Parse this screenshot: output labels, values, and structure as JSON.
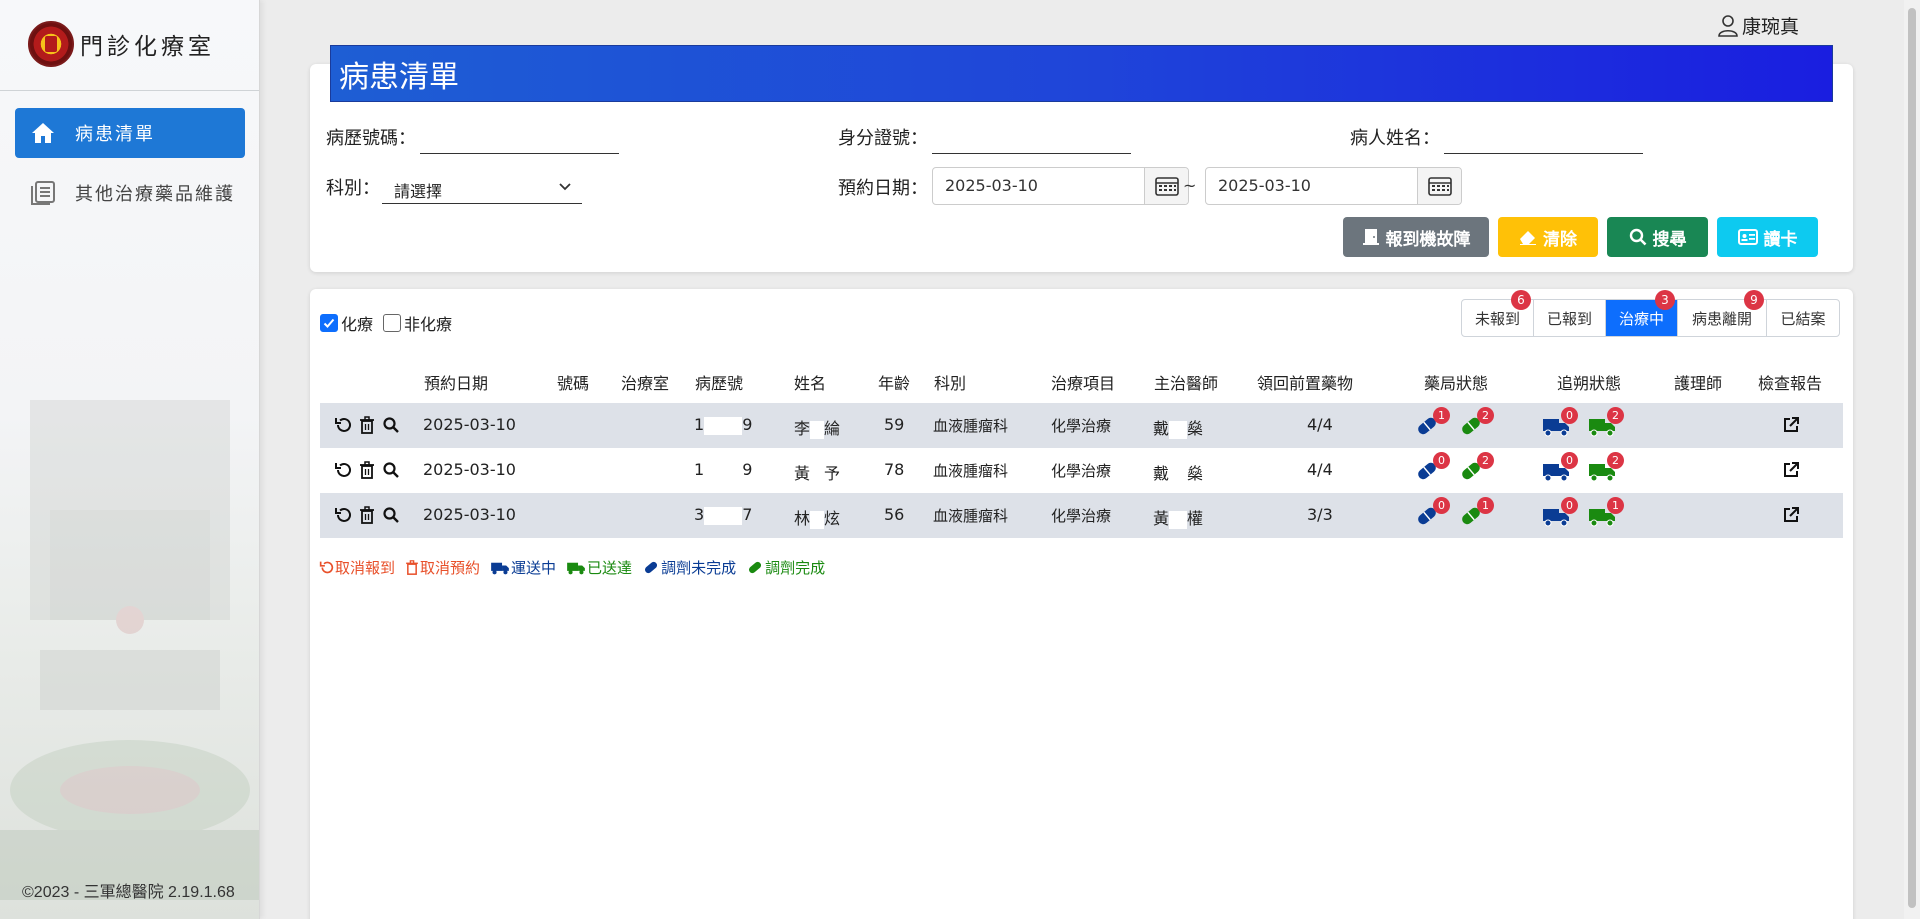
{
  "brand": {
    "title": "門診化療室"
  },
  "user": {
    "name": "康琬真"
  },
  "sidebar": {
    "items": [
      {
        "label": "病患清單",
        "icon": "home-icon",
        "active": true
      },
      {
        "label": "其他治療藥品維護",
        "icon": "document-list-icon",
        "active": false
      }
    ],
    "footer": "©2023 - 三軍總醫院 2.19.1.68"
  },
  "page_title": "病患清單",
  "search": {
    "chart_no_label": "病歷號碼：",
    "chart_no_value": "",
    "id_no_label": "身分證號：",
    "id_no_value": "",
    "patient_name_label": "病人姓名：",
    "patient_name_value": "",
    "dept_label": "科別：",
    "dept_selected": "請選擇",
    "date_label": "預約日期：",
    "date_from": "2025-03-10",
    "date_to": "2025-03-10",
    "tilde": "~"
  },
  "buttons": {
    "report_fault": "報到機故障",
    "clear": "清除",
    "search": "搜尋",
    "read_card": "讀卡"
  },
  "filters": {
    "chemo_label": "化療",
    "chemo_checked": true,
    "non_chemo_label": "非化療",
    "non_chemo_checked": false
  },
  "status_tabs": [
    {
      "label": "未報到",
      "badge": "6",
      "active": false
    },
    {
      "label": "已報到",
      "badge": "",
      "active": false
    },
    {
      "label": "治療中",
      "badge": "3",
      "active": true
    },
    {
      "label": "病患離開",
      "badge": "9",
      "active": false
    },
    {
      "label": "已結案",
      "badge": "",
      "active": false
    }
  ],
  "table": {
    "headers": [
      "預約日期",
      "號碼",
      "治療室",
      "病歷號",
      "姓名",
      "年齡",
      "科別",
      "治療項目",
      "主治醫師",
      "領回前置藥物",
      "藥局狀態",
      "追朔狀態",
      "護理師",
      "檢查報告"
    ],
    "rows": [
      {
        "date": "2025-03-10",
        "number": "",
        "room": "",
        "chart_a": "1",
        "chart_b": "9",
        "name_a": "李",
        "name_b": "綸",
        "age": "59",
        "dept": "血液腫瘤科",
        "treatment": "化學治療",
        "doctor_a": "戴",
        "doctor_b": "燊",
        "premed": "4/4",
        "pharm_blue": "1",
        "pharm_green": "2",
        "track_blue": "0",
        "track_green": "2",
        "nurse": ""
      },
      {
        "date": "2025-03-10",
        "number": "",
        "room": "",
        "chart_a": "1",
        "chart_b": "9",
        "name_a": "黃",
        "name_b": "予",
        "age": "78",
        "dept": "血液腫瘤科",
        "treatment": "化學治療",
        "doctor_a": "戴",
        "doctor_b": "燊",
        "premed": "4/4",
        "pharm_blue": "0",
        "pharm_green": "2",
        "track_blue": "0",
        "track_green": "2",
        "nurse": ""
      },
      {
        "date": "2025-03-10",
        "number": "",
        "room": "",
        "chart_a": "3",
        "chart_b": "7",
        "name_a": "林",
        "name_b": "炫",
        "age": "56",
        "dept": "血液腫瘤科",
        "treatment": "化學治療",
        "doctor_a": "黃",
        "doctor_b": "權",
        "premed": "3/3",
        "pharm_blue": "0",
        "pharm_green": "1",
        "track_blue": "0",
        "track_green": "1",
        "nurse": ""
      }
    ]
  },
  "legend": {
    "cancel_checkin": "取消報到",
    "cancel_booking": "取消預約",
    "in_transit": "運送中",
    "delivered": "已送達",
    "compounding_pending": "調劑未完成",
    "compounding_done": "調劑完成"
  },
  "colors": {
    "primary": "#1e78d6",
    "banner_start": "#1e5ed4",
    "banner_end": "#1a1ee0",
    "danger": "#dc3545",
    "warning": "#ffc107",
    "success": "#198754",
    "info": "#0dcaf0",
    "secondary": "#6c757d",
    "legend_red": "#e8502a",
    "legend_blue": "#0a3c94",
    "legend_green": "#1a8a10"
  }
}
